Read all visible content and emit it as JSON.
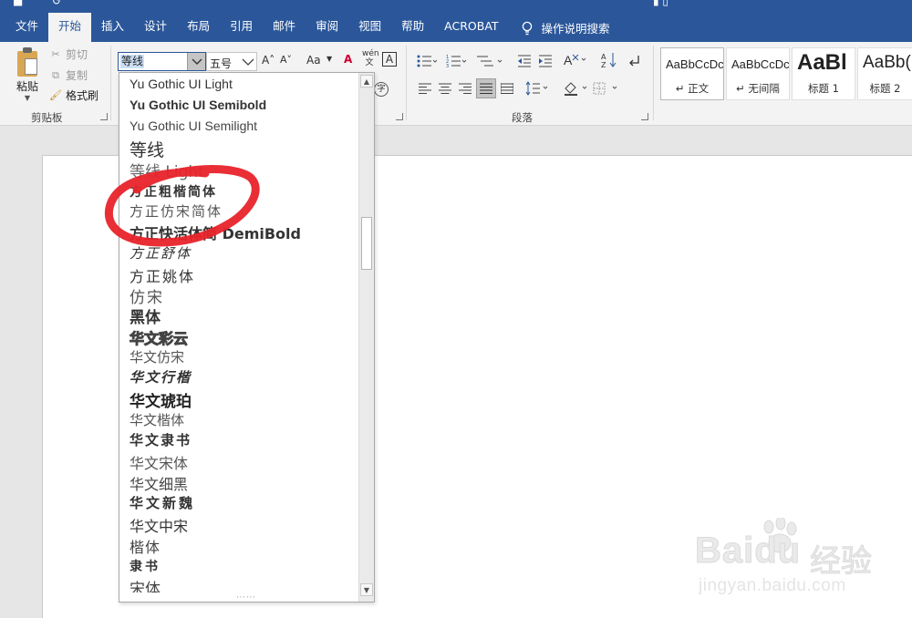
{
  "window": {
    "quick_access_glyphs": "■ ↺",
    "title_glyph": "▮ ▯"
  },
  "tabs": [
    {
      "label": "文件"
    },
    {
      "label": "开始"
    },
    {
      "label": "插入"
    },
    {
      "label": "设计"
    },
    {
      "label": "布局"
    },
    {
      "label": "引用"
    },
    {
      "label": "邮件"
    },
    {
      "label": "审阅"
    },
    {
      "label": "视图"
    },
    {
      "label": "帮助"
    },
    {
      "label": "ACROBAT"
    }
  ],
  "tell_me": {
    "label": "操作说明搜索"
  },
  "clipboard": {
    "paste_label": "粘贴",
    "cut_label": "剪切",
    "copy_label": "复制",
    "format_painter_label": "格式刷",
    "group_label": "剪贴板"
  },
  "font": {
    "current_font": "等线",
    "current_size": "五号",
    "grow_icon": "A˄",
    "shrink_icon": "A˅",
    "case_label": "Aa",
    "clear_format_icon": "A",
    "phonetic_icon": "wén 文",
    "border_icon": "A",
    "enclose_icon": "字"
  },
  "paragraph": {
    "group_label": "段落"
  },
  "styles": [
    {
      "preview": "AaBbCcDc",
      "name": "↵ 正文"
    },
    {
      "preview": "AaBbCcDc",
      "name": "↵ 无间隔"
    },
    {
      "preview": "AaBl",
      "name": "标题 1"
    },
    {
      "preview": "AaBb(",
      "name": "标题 2"
    }
  ],
  "font_list": [
    {
      "label": "Yu Gothic UI Light"
    },
    {
      "label": "Yu Gothic UI Semibold"
    },
    {
      "label": "Yu Gothic UI Semilight"
    },
    {
      "label": "等线"
    },
    {
      "label": "等线 Light"
    },
    {
      "label": "方正粗楷简体"
    },
    {
      "label": "方正仿宋简体"
    },
    {
      "label": "方正快活体简 DemiBold"
    },
    {
      "label": "方正舒体"
    },
    {
      "label": "方正姚体"
    },
    {
      "label": "仿宋"
    },
    {
      "label": "黑体"
    },
    {
      "label": "华文彩云"
    },
    {
      "label": "华文仿宋"
    },
    {
      "label": "华文行楷"
    },
    {
      "label": "华文琥珀"
    },
    {
      "label": "华文楷体"
    },
    {
      "label": "华文隶书"
    },
    {
      "label": "华文宋体"
    },
    {
      "label": "华文细黑"
    },
    {
      "label": "华文新魏"
    },
    {
      "label": "华文中宋"
    },
    {
      "label": "楷体"
    },
    {
      "label": "隶书"
    },
    {
      "label": "宋体"
    }
  ],
  "watermark": {
    "logo_text": "Baidu",
    "logo_cn": "经验",
    "url": "jingyan.baidu.com"
  },
  "colors": {
    "accent": "#2b579a",
    "annotation": "#e8232a"
  }
}
